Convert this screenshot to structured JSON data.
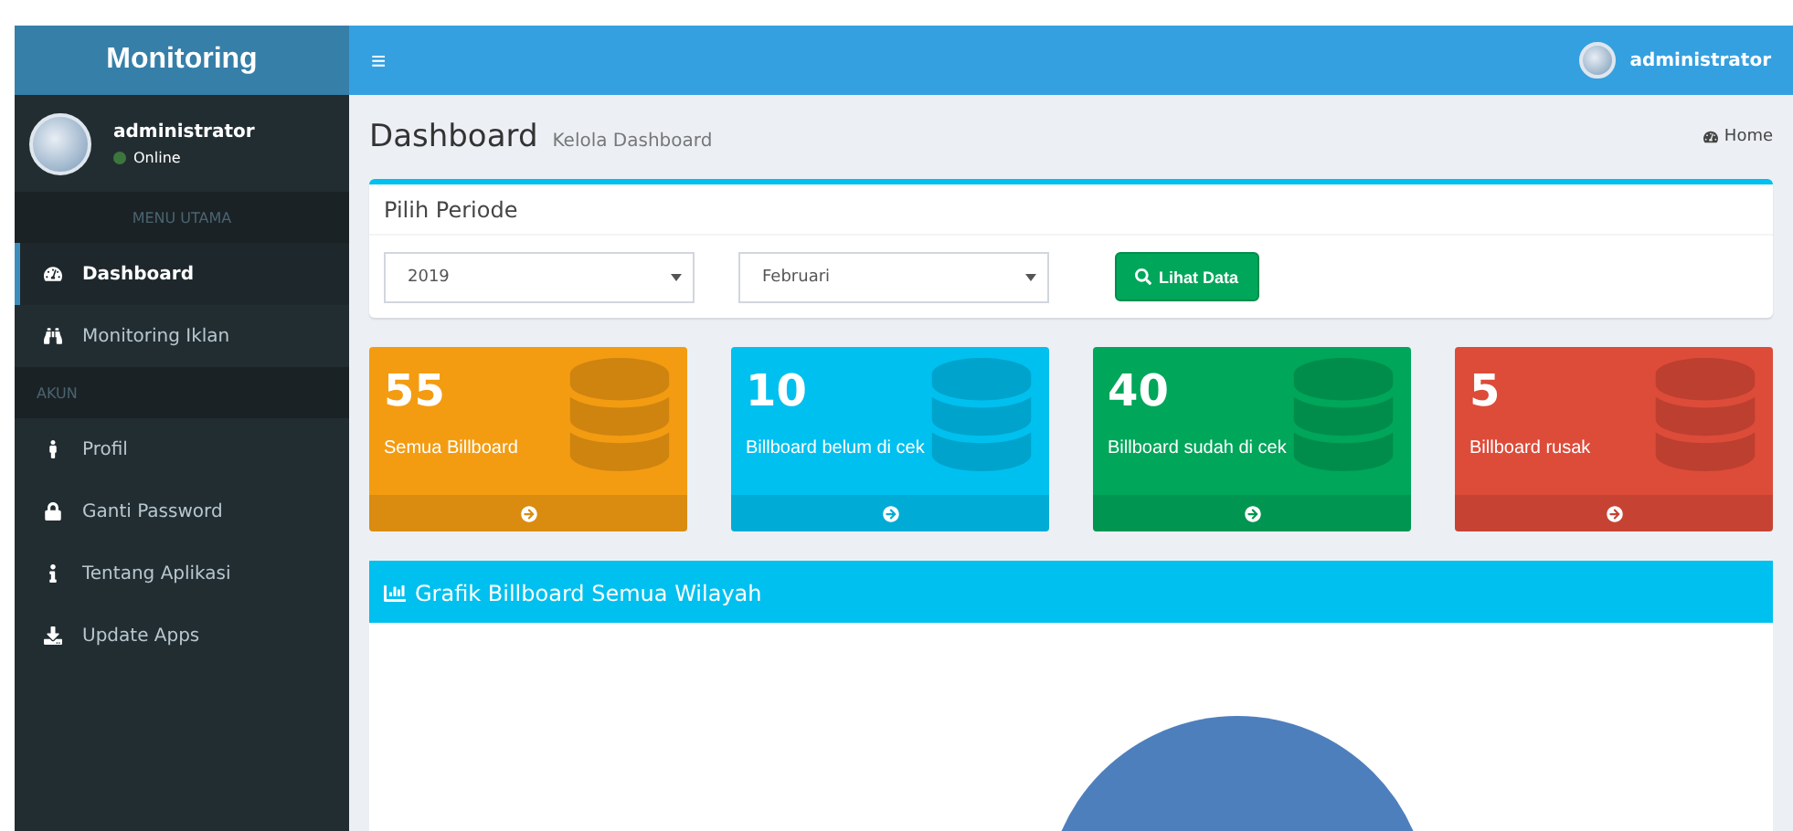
{
  "brand": "Monitoring",
  "topbar": {
    "menu_glyph": "≡",
    "user": "administrator"
  },
  "user_panel": {
    "name": "administrator",
    "status": "Online"
  },
  "sidebar": {
    "sections": [
      {
        "header": "MENU UTAMA",
        "items": [
          {
            "label": "Dashboard",
            "selected": true
          },
          {
            "label": "Monitoring Iklan",
            "selected": false
          }
        ]
      },
      {
        "header": "AKUN",
        "items": [
          {
            "label": "Profil",
            "selected": false
          },
          {
            "label": "Ganti Password",
            "selected": false
          },
          {
            "label": "Tentang Aplikasi",
            "selected": false
          },
          {
            "label": "Update Apps",
            "selected": false
          }
        ]
      }
    ]
  },
  "page": {
    "title": "Dashboard",
    "subtitle": "Kelola Dashboard",
    "breadcrumb": "Home"
  },
  "period": {
    "title": "Pilih Periode",
    "year": "2019",
    "month": "Februari",
    "button": "Lihat Data"
  },
  "stats": [
    {
      "value": "55",
      "label": "Semua Billboard",
      "color": "#f39c12"
    },
    {
      "value": "10",
      "label": "Billboard belum di cek",
      "color": "#00c0ef"
    },
    {
      "value": "40",
      "label": "Billboard sudah di cek",
      "color": "#00a65a"
    },
    {
      "value": "5",
      "label": "Billboard rusak",
      "color": "#dd4b39"
    }
  ],
  "chart_panel": {
    "title": "Grafik Billboard Semua Wilayah"
  }
}
